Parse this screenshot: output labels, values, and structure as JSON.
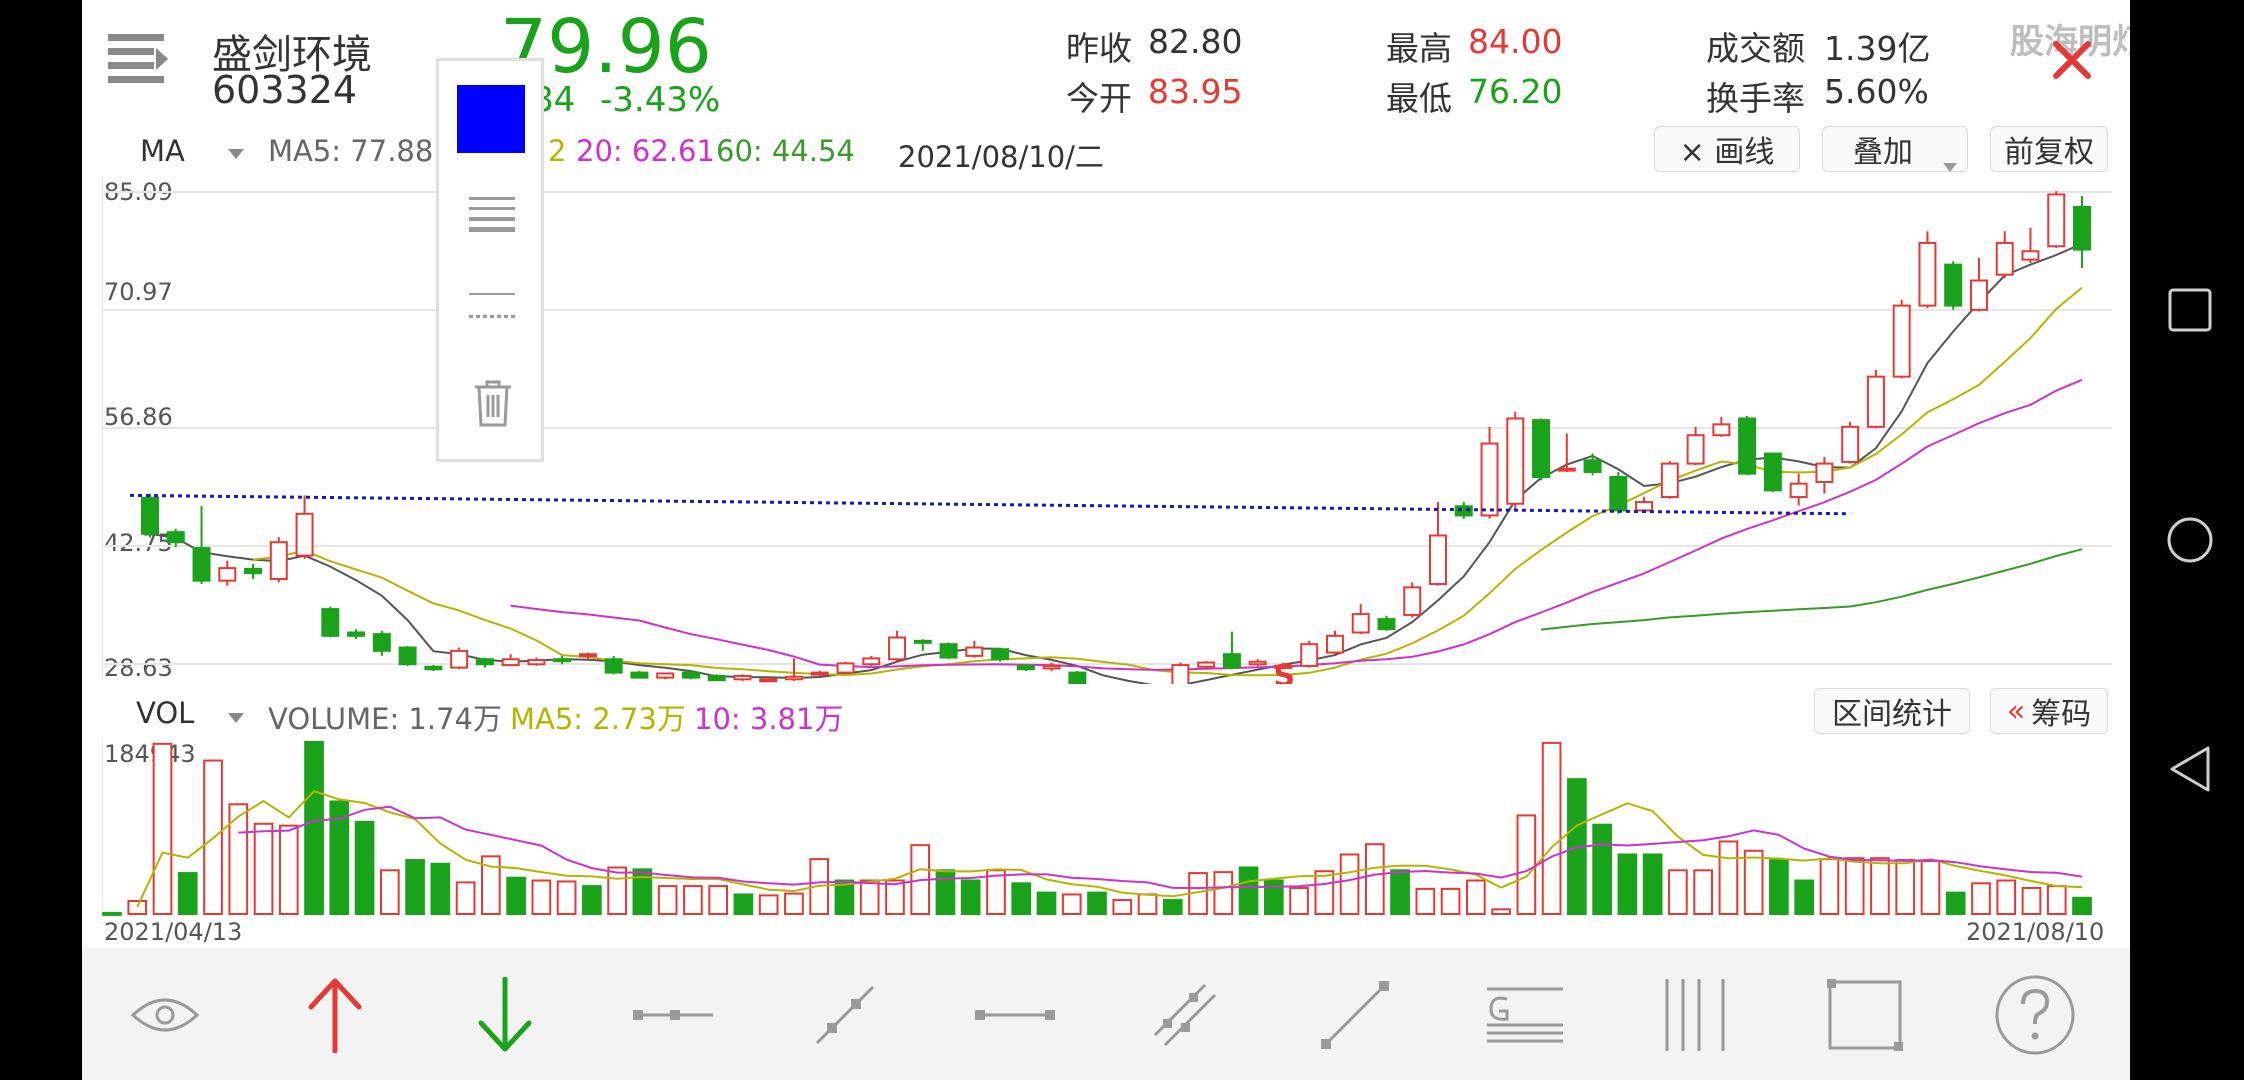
{
  "stock": {
    "name": "盛剑环境",
    "code": "603324",
    "price": "79.96",
    "change": "-2.84",
    "change_pct": "-3.43%",
    "change_visible": "84"
  },
  "stats": {
    "prev_close_label": "昨收",
    "prev_close": "82.80",
    "open_label": "今开",
    "open": "83.95",
    "high_label": "最高",
    "high": "84.00",
    "low_label": "最低",
    "low": "76.20",
    "turnover_label": "成交额",
    "turnover": "1.39亿",
    "turnover_rate_label": "换手率",
    "turnover_rate": "5.60%"
  },
  "watermark": "股海明灯",
  "ma_row": {
    "selector": "MA",
    "ma5": "MA5: 77.88",
    "ma10_tail": "2",
    "ma20": "20: 62.61",
    "ma60": "60: 44.54",
    "date": "2021/08/10/二"
  },
  "buttons": {
    "draw_line": "× 画线",
    "overlay": "叠加",
    "adjust": "前复权",
    "range_stats": "区间统计",
    "chips": "筹码"
  },
  "vol_row": {
    "selector": "VOL",
    "volume": "VOLUME: 1.74万",
    "ma5": "MA5: 2.73万",
    "ma10": "10: 3.81万"
  },
  "axis": {
    "y_labels": [
      "85.09",
      "70.97",
      "56.86",
      "42.75",
      "28.63"
    ],
    "vol_max": "184943",
    "date_start": "2021/04/13",
    "date_end": "2021/08/10"
  },
  "marker": "S",
  "colors": {
    "up": "#e53935",
    "down": "#1aa31a",
    "ma5": "#555555",
    "ma10": "#b5b500",
    "ma20": "#cc33cc",
    "ma60": "#3a9a2a",
    "trendline": "#1a1aa0",
    "popup_swatch": "#0000ff"
  },
  "toolbar_icons": [
    "eye-icon",
    "arrow-up-icon",
    "arrow-down-icon",
    "segment-icon",
    "ray-icon",
    "horizontal-line-icon",
    "parallel-line-icon",
    "diagonal-line-icon",
    "gann-icon",
    "vertical-lines-icon",
    "rectangle-icon",
    "help-icon"
  ],
  "chart_data": {
    "type": "candlestick",
    "ylim": [
      28.63,
      85.09
    ],
    "candles": [
      [
        48.5,
        44.2,
        49.0,
        43.8
      ],
      [
        44.4,
        43.2,
        44.8,
        42.6
      ],
      [
        42.5,
        38.6,
        47.5,
        38.2
      ],
      [
        38.6,
        40.1,
        41.0,
        38.0
      ],
      [
        40.0,
        39.5,
        40.6,
        38.8
      ],
      [
        38.8,
        43.2,
        43.8,
        38.4
      ],
      [
        41.6,
        46.6,
        48.8,
        41.2
      ],
      [
        35.2,
        32.0,
        35.5,
        31.8
      ],
      [
        32.4,
        32.0,
        32.8,
        31.6
      ],
      [
        32.2,
        30.2,
        32.6,
        29.6
      ],
      [
        30.6,
        28.6,
        30.8,
        28.4
      ],
      [
        28.3,
        28.0,
        28.5,
        27.8
      ],
      [
        28.2,
        30.2,
        30.6,
        28.0
      ],
      [
        29.2,
        28.6,
        29.4,
        28.2
      ],
      [
        28.5,
        29.2,
        29.8,
        28.4
      ],
      [
        28.6,
        29.1,
        29.4,
        28.4
      ],
      [
        29.2,
        29.0,
        29.6,
        28.6
      ],
      [
        29.6,
        29.8,
        30.0,
        29.2
      ],
      [
        29.2,
        27.6,
        29.6,
        27.4
      ],
      [
        27.6,
        27.0,
        27.8,
        26.9
      ],
      [
        27.0,
        27.5,
        27.6,
        26.8
      ],
      [
        27.6,
        27.0,
        27.9,
        26.8
      ],
      [
        27.2,
        26.7,
        27.4,
        26.6
      ],
      [
        26.8,
        27.2,
        27.4,
        26.6
      ],
      [
        26.8,
        26.8,
        27.0,
        26.6
      ],
      [
        26.8,
        27.1,
        29.3,
        26.6
      ],
      [
        27.4,
        27.6,
        27.8,
        27.2
      ],
      [
        27.6,
        28.7,
        28.9,
        27.5
      ],
      [
        28.6,
        29.3,
        29.6,
        28.4
      ],
      [
        29.2,
        31.8,
        32.6,
        29.0
      ],
      [
        31.4,
        31.3,
        31.6,
        30.2
      ],
      [
        31.0,
        29.4,
        31.2,
        29.2
      ],
      [
        29.6,
        30.6,
        31.4,
        29.4
      ],
      [
        30.4,
        29.2,
        30.6,
        28.9
      ],
      [
        28.4,
        28.0,
        28.6,
        27.8
      ],
      [
        28.1,
        28.4,
        28.8,
        27.8
      ],
      [
        27.6,
        25.8,
        27.8,
        25.6
      ],
      [
        25.6,
        25.0,
        25.8,
        24.8
      ],
      [
        24.8,
        25.8,
        26.0,
        24.6
      ],
      [
        25.7,
        25.4,
        26.0,
        25.2
      ],
      [
        25.4,
        28.5,
        28.8,
        25.2
      ],
      [
        28.3,
        28.8,
        29.0,
        28.0
      ],
      [
        29.8,
        28.2,
        32.5,
        28.0
      ],
      [
        28.6,
        28.9,
        29.2,
        28.4
      ],
      [
        28.2,
        28.4,
        28.8,
        28.0
      ],
      [
        28.4,
        31.0,
        31.4,
        28.2
      ],
      [
        30.0,
        32.0,
        32.6,
        29.8
      ],
      [
        32.4,
        34.6,
        35.8,
        32.2
      ],
      [
        34.0,
        32.8,
        34.4,
        32.6
      ],
      [
        34.5,
        37.8,
        38.4,
        34.2
      ],
      [
        38.2,
        44.0,
        48.0,
        38.0
      ],
      [
        47.5,
        46.4,
        48.0,
        46.0
      ],
      [
        46.4,
        55.0,
        57.0,
        46.0
      ],
      [
        47.8,
        58.0,
        58.8,
        47.2
      ],
      [
        57.8,
        51.0,
        58.0,
        50.6
      ],
      [
        51.8,
        52.0,
        56.2,
        51.6
      ],
      [
        53.0,
        51.6,
        53.8,
        51.2
      ],
      [
        51.0,
        47.0,
        51.6,
        46.6
      ],
      [
        47.0,
        48.0,
        48.6,
        46.8
      ],
      [
        48.6,
        52.6,
        52.9,
        48.4
      ],
      [
        52.6,
        56.0,
        57.0,
        52.4
      ],
      [
        56.0,
        57.3,
        58.2,
        55.8
      ],
      [
        58.0,
        51.4,
        58.3,
        51.2
      ],
      [
        53.8,
        49.4,
        53.8,
        49.2
      ],
      [
        48.6,
        50.2,
        51.4,
        47.6
      ],
      [
        50.4,
        52.6,
        53.4,
        49.0
      ],
      [
        52.8,
        57.0,
        57.6,
        52.6
      ],
      [
        57.0,
        63.0,
        63.8,
        56.8
      ],
      [
        63.0,
        71.5,
        72.2,
        62.8
      ],
      [
        71.5,
        79.0,
        80.4,
        71.2
      ],
      [
        76.4,
        71.5,
        76.8,
        71.0
      ],
      [
        71.0,
        74.5,
        77.2,
        70.8
      ],
      [
        75.2,
        79.0,
        80.4,
        74.8
      ],
      [
        77.0,
        78.0,
        80.8,
        76.6
      ],
      [
        78.6,
        84.8,
        85.2,
        78.4
      ],
      [
        83.3,
        78.2,
        84.6,
        76.0
      ]
    ],
    "volumes": [
      [
        1200,
        0
      ],
      [
        14000,
        1
      ],
      [
        183000,
        1
      ],
      [
        44000,
        0
      ],
      [
        165000,
        1
      ],
      [
        118000,
        1
      ],
      [
        97000,
        1
      ],
      [
        95000,
        1
      ],
      [
        184943,
        0
      ],
      [
        121000,
        0
      ],
      [
        99000,
        0
      ],
      [
        47000,
        1
      ],
      [
        58000,
        0
      ],
      [
        54000,
        0
      ],
      [
        34000,
        1
      ],
      [
        62000,
        1
      ],
      [
        39000,
        0
      ],
      [
        36000,
        1
      ],
      [
        35000,
        1
      ],
      [
        30000,
        0
      ],
      [
        50000,
        1
      ],
      [
        48000,
        0
      ],
      [
        30000,
        1
      ],
      [
        30000,
        1
      ],
      [
        30000,
        1
      ],
      [
        21000,
        0
      ],
      [
        20000,
        1
      ],
      [
        22000,
        1
      ],
      [
        59000,
        1
      ],
      [
        36000,
        0
      ],
      [
        36000,
        1
      ],
      [
        36000,
        1
      ],
      [
        74000,
        1
      ],
      [
        47000,
        0
      ],
      [
        36000,
        0
      ],
      [
        47000,
        1
      ],
      [
        33000,
        0
      ],
      [
        23000,
        0
      ],
      [
        21000,
        1
      ],
      [
        23000,
        0
      ],
      [
        15000,
        1
      ],
      [
        21000,
        1
      ],
      [
        15000,
        0
      ],
      [
        44000,
        1
      ],
      [
        45000,
        1
      ],
      [
        50000,
        0
      ],
      [
        36000,
        0
      ],
      [
        28000,
        1
      ],
      [
        46000,
        1
      ],
      [
        64000,
        1
      ],
      [
        75000,
        1
      ],
      [
        47000,
        0
      ],
      [
        27000,
        1
      ],
      [
        27000,
        1
      ],
      [
        36000,
        1
      ],
      [
        5000,
        1
      ],
      [
        106000,
        1
      ],
      [
        184000,
        1
      ],
      [
        145000,
        0
      ],
      [
        96000,
        0
      ],
      [
        64000,
        0
      ],
      [
        64000,
        0
      ],
      [
        47000,
        1
      ],
      [
        47000,
        1
      ],
      [
        78000,
        1
      ],
      [
        68000,
        1
      ],
      [
        58000,
        0
      ],
      [
        36000,
        0
      ],
      [
        59000,
        1
      ],
      [
        60000,
        1
      ],
      [
        60000,
        1
      ],
      [
        58000,
        1
      ],
      [
        57000,
        1
      ],
      [
        23000,
        0
      ],
      [
        33000,
        1
      ],
      [
        36000,
        1
      ],
      [
        28000,
        1
      ],
      [
        30000,
        1
      ],
      [
        17400,
        0
      ]
    ]
  }
}
